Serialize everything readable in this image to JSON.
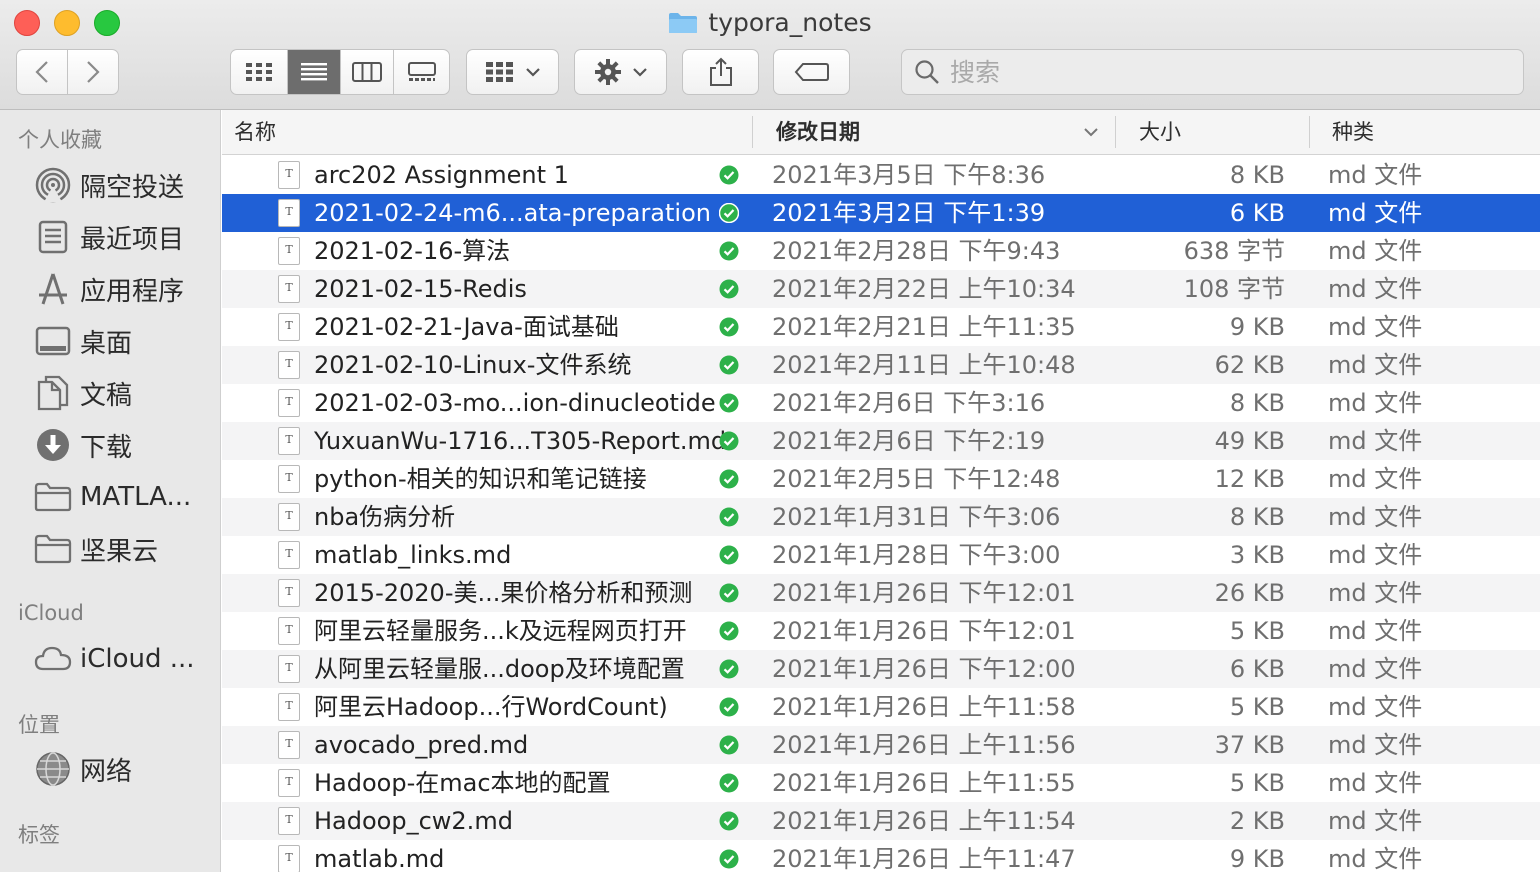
{
  "window": {
    "title": "typora_notes"
  },
  "toolbar": {
    "search_placeholder": "搜索"
  },
  "sidebar": {
    "sections": {
      "favorites": "个人收藏",
      "icloud": "iCloud",
      "locations": "位置",
      "tags": "标签"
    },
    "items": [
      {
        "label": "隔空投送",
        "icon": "airdrop-icon"
      },
      {
        "label": "最近项目",
        "icon": "recents-icon"
      },
      {
        "label": "应用程序",
        "icon": "applications-icon"
      },
      {
        "label": "桌面",
        "icon": "desktop-icon"
      },
      {
        "label": "文稿",
        "icon": "documents-icon"
      },
      {
        "label": "下载",
        "icon": "downloads-icon"
      },
      {
        "label": "MATLA...",
        "icon": "folder-icon"
      },
      {
        "label": "坚果云",
        "icon": "folder-icon"
      },
      {
        "label": "iCloud ...",
        "icon": "icloud-icon"
      },
      {
        "label": "网络",
        "icon": "network-icon"
      }
    ]
  },
  "columns": {
    "name": "名称",
    "date": "修改日期",
    "size": "大小",
    "kind": "种类"
  },
  "files": [
    {
      "name": "arc202 Assignment 1",
      "date": "2021年3月5日 下午8:36",
      "size": "8 KB",
      "kind": "md 文件"
    },
    {
      "name": "2021-02-24-m6...ata-preparation",
      "date": "2021年3月2日 下午1:39",
      "size": "6 KB",
      "kind": "md 文件"
    },
    {
      "name": "2021-02-16-算法",
      "date": "2021年2月28日 下午9:43",
      "size": "638 字节",
      "kind": "md 文件"
    },
    {
      "name": "2021-02-15-Redis",
      "date": "2021年2月22日 上午10:34",
      "size": "108 字节",
      "kind": "md 文件"
    },
    {
      "name": "2021-02-21-Java-面试基础",
      "date": "2021年2月21日 上午11:35",
      "size": "9 KB",
      "kind": "md 文件"
    },
    {
      "name": "2021-02-10-Linux-文件系统",
      "date": "2021年2月11日 上午10:48",
      "size": "62 KB",
      "kind": "md 文件"
    },
    {
      "name": "2021-02-03-mo...ion-dinucleotide",
      "date": "2021年2月6日 下午3:16",
      "size": "8 KB",
      "kind": "md 文件"
    },
    {
      "name": "YuxuanWu-1716...T305-Report.md",
      "date": "2021年2月6日 下午2:19",
      "size": "49 KB",
      "kind": "md 文件"
    },
    {
      "name": "python-相关的知识和笔记链接",
      "date": "2021年2月5日 下午12:48",
      "size": "12 KB",
      "kind": "md 文件"
    },
    {
      "name": "nba伤病分析",
      "date": "2021年1月31日 下午3:06",
      "size": "8 KB",
      "kind": "md 文件"
    },
    {
      "name": "matlab_links.md",
      "date": "2021年1月28日 下午3:00",
      "size": "3 KB",
      "kind": "md 文件"
    },
    {
      "name": "2015-2020-美...果价格分析和预测",
      "date": "2021年1月26日 下午12:01",
      "size": "26 KB",
      "kind": "md 文件"
    },
    {
      "name": "阿里云轻量服务...k及远程网页打开",
      "date": "2021年1月26日 下午12:01",
      "size": "5 KB",
      "kind": "md 文件"
    },
    {
      "name": "从阿里云轻量服...doop及环境配置",
      "date": "2021年1月26日 下午12:00",
      "size": "6 KB",
      "kind": "md 文件"
    },
    {
      "name": "阿里云Hadoop...行WordCount)",
      "date": "2021年1月26日 上午11:58",
      "size": "5 KB",
      "kind": "md 文件"
    },
    {
      "name": "avocado_pred.md",
      "date": "2021年1月26日 上午11:56",
      "size": "37 KB",
      "kind": "md 文件"
    },
    {
      "name": "Hadoop-在mac本地的配置",
      "date": "2021年1月26日 上午11:55",
      "size": "5 KB",
      "kind": "md 文件"
    },
    {
      "name": "Hadoop_cw2.md",
      "date": "2021年1月26日 上午11:54",
      "size": "2 KB",
      "kind": "md 文件"
    },
    {
      "name": "matlab.md",
      "date": "2021年1月26日 上午11:47",
      "size": "9 KB",
      "kind": "md 文件"
    }
  ],
  "selected_index": 1,
  "colors": {
    "selection": "#2060d6",
    "sync_check": "#2db14a",
    "alt_row": "#f4f4f5"
  }
}
